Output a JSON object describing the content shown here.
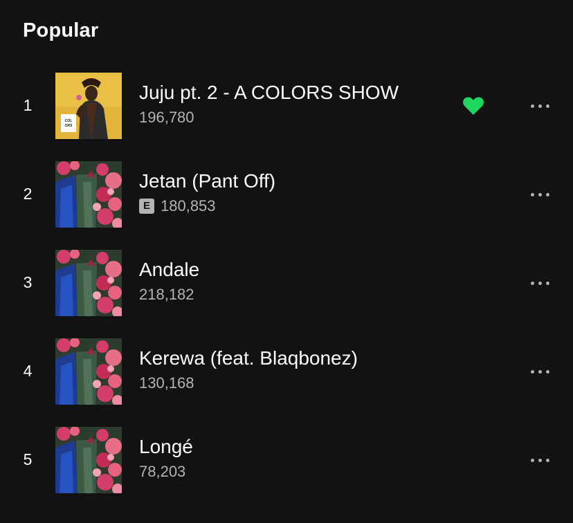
{
  "section": {
    "title": "Popular"
  },
  "tracks": [
    {
      "index": "1",
      "title": "Juju pt. 2 - A COLORS SHOW",
      "plays": "196,780",
      "explicit": false,
      "liked": true,
      "cover_badge_text": [
        "COL",
        "ORS"
      ]
    },
    {
      "index": "2",
      "title": "Jetan (Pant Off)",
      "plays": "180,853",
      "explicit": true,
      "explicit_label": "E",
      "liked": false
    },
    {
      "index": "3",
      "title": "Andale",
      "plays": "218,182",
      "explicit": false,
      "liked": false
    },
    {
      "index": "4",
      "title": "Kerewa (feat. Blaqbonez)",
      "plays": "130,168",
      "explicit": false,
      "liked": false
    },
    {
      "index": "5",
      "title": "Longé",
      "plays": "78,203",
      "explicit": false,
      "liked": false
    }
  ],
  "icons": {
    "like": "heart-icon",
    "more": "more-options-icon"
  },
  "colors": {
    "background": "#121212",
    "primary_text": "#ffffff",
    "secondary_text": "#b3b3b3",
    "liked_heart": "#1ed760"
  }
}
